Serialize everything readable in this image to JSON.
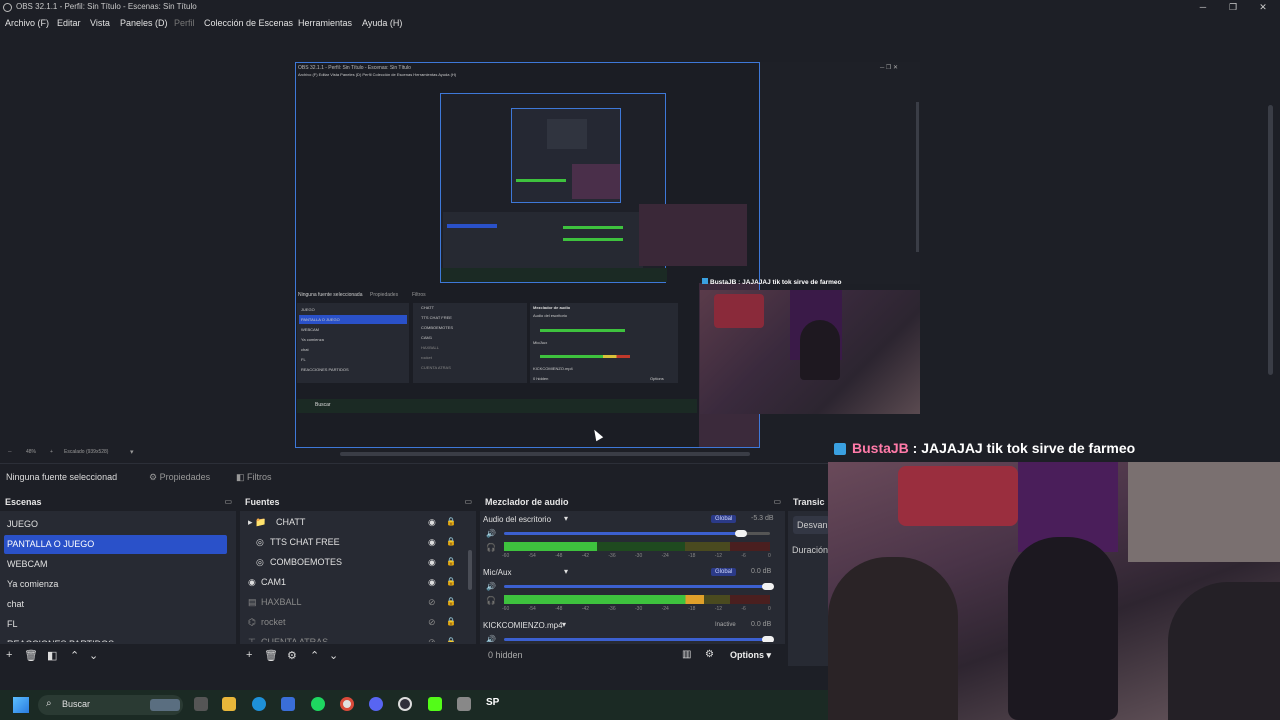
{
  "window": {
    "title": "OBS 32.1.1 - Perfil: Sin Título - Escenas: Sin Título",
    "controls": {
      "minimize": "─",
      "maximize": "❐",
      "close": "✕"
    }
  },
  "menu": {
    "file": "Archivo (F)",
    "edit": "Editar",
    "view": "Vista",
    "docks": "Paneles (D)",
    "profile": "Perfil",
    "scene_collection": "Colección de Escenas",
    "tools": "Herramientas",
    "help": "Ayuda (H)"
  },
  "preview": {
    "zoom": "48%",
    "scaling": "Escalado (939x528)",
    "nested_chat": "BustaJB : JAJAJAJ tik tok sirve de farmeo",
    "nested_chat_small": "BustaJB : JAJAJAJ tik tok sirve de farmeo",
    "nested": {
      "title": "OBS 32.1.1 - Perfil: Sin Título - Escenas: Sin Título",
      "menu": "Archivo (F)   Editar   Vista   Paneles (D)   Perfil   Colección de Escenas   Herramientas   Ayuda (H)",
      "context": "Ninguna fuente seleccionada",
      "props": "Propiedades",
      "filters": "Filtros",
      "scenes": [
        "JUEGO",
        "PANTALLA O JUEGO",
        "WEBCAM",
        "Ya comienza",
        "chat",
        "FL",
        "REACCIONES PARTIDOS"
      ],
      "sources": [
        "CHATT",
        "TTS CHAT FREE",
        "COMBOEMOTES",
        "CAM1",
        "HAXBALL",
        "rocket",
        "CUENTA ATRAS"
      ],
      "mixer_title": "Mezclador de audio",
      "mixer_ch1": "Audio del escritorio",
      "mixer_ch2": "Mic/Aux",
      "mixer_ch3": "KICKCOMIENZO.mp4",
      "hidden": "0 hidden",
      "options": "Options",
      "search": "Buscar"
    }
  },
  "context_bar": {
    "no_source": "Ninguna fuente seleccionad",
    "properties": "Propiedades",
    "filters": "Filtros"
  },
  "scenes": {
    "title": "Escenas",
    "items": [
      "JUEGO",
      "PANTALLA O JUEGO",
      "WEBCAM",
      "Ya comienza",
      "chat",
      "FL",
      "REACCIONES PARTIDOS"
    ],
    "active_index": 1
  },
  "sources": {
    "title": "Fuentes",
    "items": [
      {
        "name": "CHATT",
        "icon": "folder-icon",
        "visible": true
      },
      {
        "name": "TTS CHAT FREE",
        "icon": "browser-icon",
        "visible": true
      },
      {
        "name": "COMBOEMOTES",
        "icon": "browser-icon",
        "visible": true
      },
      {
        "name": "CAM1",
        "icon": "camera-icon",
        "visible": true
      },
      {
        "name": "HAXBALL",
        "icon": "window-capture-icon",
        "visible": false
      },
      {
        "name": "rocket",
        "icon": "game-capture-icon",
        "visible": false
      },
      {
        "name": "CUENTA ATRAS",
        "icon": "text-icon",
        "visible": false
      }
    ]
  },
  "mixer": {
    "title": "Mezclador de audio",
    "channels": [
      {
        "name": "Audio del escritorio",
        "badge": "Global",
        "db": "-5.3 dB",
        "volume": 0.9,
        "level": 0.35
      },
      {
        "name": "Mic/Aux",
        "badge": "Global",
        "db": "0.0 dB",
        "volume": 1.0,
        "level": 0.75
      },
      {
        "name": "KICKCOMIENZO.mp4",
        "badge": "Inactive",
        "db": "0.0 dB",
        "volume": 1.0,
        "level": 0
      }
    ],
    "scale": [
      "-60",
      "-54",
      "-48",
      "-42",
      "-36",
      "-30",
      "-24",
      "-18",
      "-12",
      "-6",
      "0"
    ],
    "hidden": "0 hidden",
    "options": "Options"
  },
  "transitions": {
    "title": "Transic",
    "select": "Desvan",
    "duration": "Duración"
  },
  "overlay_chat": {
    "user": "BustaJB",
    "message": " : JAJAJAJ tik tok sirve de farmeo"
  },
  "taskbar": {
    "search": "Buscar",
    "app_label": "SP"
  },
  "colors": {
    "accent": "#2a51c9",
    "background": "#1d1f26",
    "dock": "#272a33",
    "meter_green": "#3ec23e",
    "meter_yellow": "#d8c23a",
    "meter_red": "#c0392b",
    "chat_user": "#ff7aa8"
  }
}
